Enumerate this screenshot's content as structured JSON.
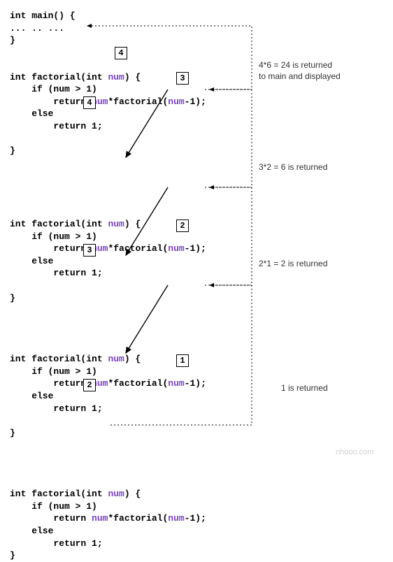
{
  "main_block": "int main() {\n... .. ...\n}",
  "factorial_blocks": [
    {
      "line1": "int factorial(int ",
      "param": "num",
      "line1_end": ") {",
      "line2": "    if (num > 1)",
      "line3a": "        return ",
      "line3b": "num",
      "line3c": "*factorial(",
      "line3d": "num",
      "line3e": "-1);",
      "line4": "    else",
      "line5": "        return 1;",
      "close": "}",
      "box_top": "4",
      "box_arg": "3",
      "box_else": "4"
    },
    {
      "line1": "int factorial(int ",
      "param": "num",
      "line1_end": ") {",
      "line2": "    if (num > 1)",
      "line3a": "        return ",
      "line3b": "num",
      "line3c": "*factorial(",
      "line3d": "num",
      "line3e": "-1);",
      "line4": "    else",
      "line5": "        return 1;",
      "close": "}",
      "box_top": "",
      "box_arg": "2",
      "box_else": "3"
    },
    {
      "line1": "int factorial(int ",
      "param": "num",
      "line1_end": ") {",
      "line2": "    if (num > 1)",
      "line3a": "        return ",
      "line3b": "num",
      "line3c": "*factorial(",
      "line3d": "num",
      "line3e": "-1);",
      "line4": "    else",
      "line5": "        return 1;",
      "close": "}",
      "box_top": "",
      "box_arg": "1",
      "box_else": "2"
    },
    {
      "line1": "int factorial(int ",
      "param": "num",
      "line1_end": ") {",
      "line2": "    if (num > 1)",
      "line3a": "        return ",
      "line3b": "num",
      "line3c": "*factorial(",
      "line3d": "num",
      "line3e": "-1);",
      "line4": "    else",
      "line5": "        return 1;",
      "close": "}",
      "box_top": "",
      "box_arg": "",
      "box_else": ""
    }
  ],
  "annotations": [
    "4*6 = 24 is returned\nto main and displayed",
    "3*2 = 6 is returned",
    "2*1 = 2 is returned",
    "1 is returned"
  ],
  "watermark": "nhooo.com"
}
